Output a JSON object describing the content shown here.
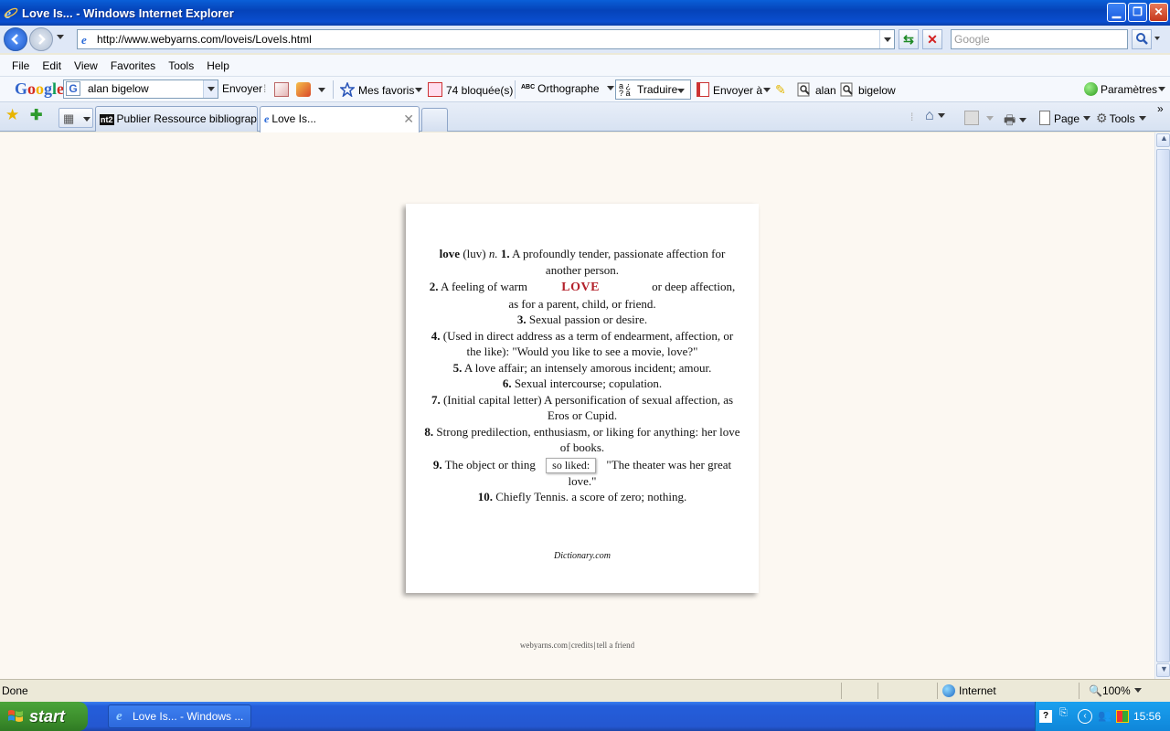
{
  "window": {
    "title": "Love Is... - Windows Internet Explorer"
  },
  "address": {
    "url": "http://www.webyarns.com/loveis/LoveIs.html",
    "search_placeholder": "Google"
  },
  "menu": [
    "File",
    "Edit",
    "View",
    "Favorites",
    "Tools",
    "Help"
  ],
  "google_toolbar": {
    "logo": "Google",
    "search_value": "alan bigelow",
    "send_label": "Envoyer",
    "favorites_label": "Mes favoris",
    "blocked_label": "74 bloquée(s)",
    "spell_label": "Orthographe",
    "spell_icon_text": "ABC",
    "translate_label": "Traduire",
    "sendto_label": "Envoyer à",
    "term1": "alan",
    "term2": "bigelow",
    "settings_label": "Paramètres"
  },
  "tabs": [
    {
      "label": "Publier Ressource bibliograph...",
      "icon": "nt2"
    },
    {
      "label": "Love Is..."
    }
  ],
  "command_bar": {
    "page_label": "Page",
    "tools_label": "Tools"
  },
  "content": {
    "definitions": {
      "d1": {
        "word": "love",
        "pron": "(luv)",
        "pos": "n.",
        "num": "1.",
        "text": "A profoundly tender, passionate affection for another person."
      },
      "d2": {
        "num": "2.",
        "before": "A feeling of warm",
        "overlay": "LOVE",
        "after": "or deep affection, as for a parent, child, or friend."
      },
      "d3": {
        "num": "3.",
        "text": "Sexual passion or desire."
      },
      "d4": {
        "num": "4.",
        "text": "(Used in direct address as a term of endearment, affection, or the like): \"Would you like to see a movie, love?\""
      },
      "d5": {
        "num": "5.",
        "text": "A love affair; an intensely amorous incident; amour."
      },
      "d6": {
        "num": "6.",
        "text": "Sexual intercourse; copulation."
      },
      "d7": {
        "num": "7.",
        "text": "(Initial capital letter) A personification of sexual affection, as Eros or Cupid."
      },
      "d8": {
        "num": "8.",
        "text": "Strong predilection, enthusiasm, or liking for anything: her love of books."
      },
      "d9": {
        "num": "9.",
        "before": "The object or thing",
        "chip": "so liked:",
        "after": "\"The theater was her great love.\""
      },
      "d10": {
        "num": "10.",
        "text": "Chiefly Tennis. a score of zero; nothing."
      }
    },
    "source": "Dictionary.com",
    "footer_links": [
      "webyarns.com",
      "credits",
      "tell a friend"
    ]
  },
  "status": {
    "text": "Done",
    "zone": "Internet",
    "zoom": "100%"
  },
  "taskbar": {
    "start_label": "start",
    "item_label": "Love Is... - Windows ...",
    "clock": "15:56"
  },
  "colors": {
    "page_background": "#fcf8f2",
    "love_overlay": "#b4222c",
    "titlebar": "#0a4ed0"
  }
}
